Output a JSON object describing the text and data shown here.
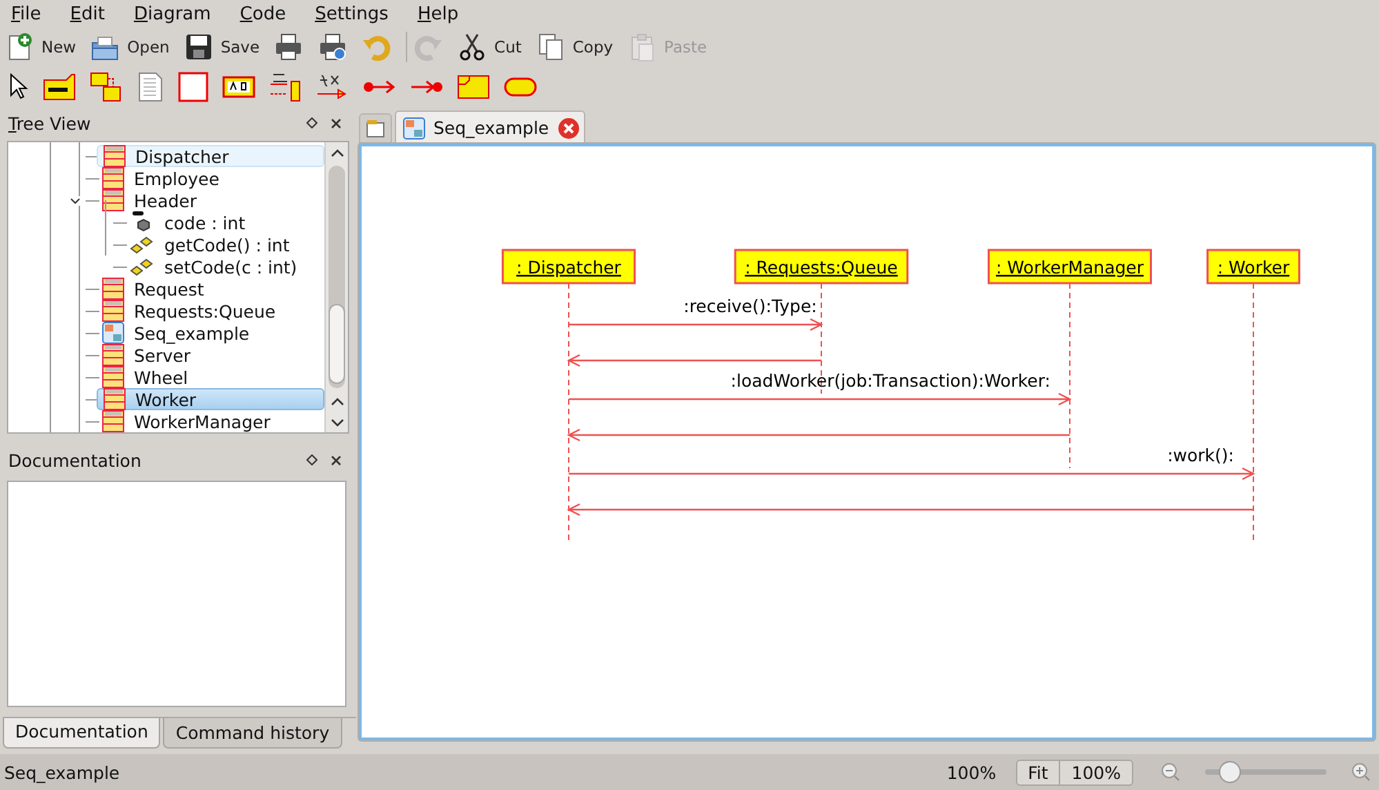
{
  "menu": [
    {
      "label": "File"
    },
    {
      "label": "Edit"
    },
    {
      "label": "Diagram"
    },
    {
      "label": "Code"
    },
    {
      "label": "Settings"
    },
    {
      "label": "Help"
    }
  ],
  "toolbar": [
    {
      "label": "New",
      "disabled": false
    },
    {
      "label": "Open",
      "disabled": false
    },
    {
      "label": "Save",
      "disabled": false
    },
    {
      "disabled": false
    },
    {
      "disabled": false
    },
    {
      "disabled": false
    },
    {
      "disabled": true
    },
    {
      "label": "Cut",
      "disabled": false
    },
    {
      "label": "Copy",
      "disabled": false
    },
    {
      "label": "Paste",
      "disabled": true
    }
  ],
  "tree_view": {
    "title": "Tree View",
    "items": [
      {
        "label": "Dispatcher",
        "kind": "class",
        "selected": false,
        "hovered": true
      },
      {
        "label": "Employee",
        "kind": "class",
        "selected": false,
        "hovered": false
      },
      {
        "label": "Header",
        "kind": "class",
        "selected": false,
        "hovered": false,
        "expanded": true,
        "children": [
          {
            "label": "code : int",
            "kind": "attribute",
            "selected": false,
            "hovered": false
          },
          {
            "label": "getCode() : int",
            "kind": "operation",
            "selected": false,
            "hovered": false
          },
          {
            "label": "setCode(c : int)",
            "kind": "operation",
            "selected": false,
            "hovered": false
          }
        ]
      },
      {
        "label": "Request",
        "kind": "class",
        "selected": false,
        "hovered": false
      },
      {
        "label": "Requests:Queue",
        "kind": "class",
        "selected": false,
        "hovered": false
      },
      {
        "label": "Seq_example",
        "kind": "diagram",
        "selected": false,
        "hovered": false
      },
      {
        "label": "Server",
        "kind": "class",
        "selected": false,
        "hovered": false
      },
      {
        "label": "Wheel",
        "kind": "class",
        "selected": false,
        "hovered": false
      },
      {
        "label": "Worker",
        "kind": "class",
        "selected": true,
        "hovered": false
      },
      {
        "label": "WorkerManager",
        "kind": "class",
        "selected": false,
        "hovered": false
      }
    ]
  },
  "documentation": {
    "title": "Documentation"
  },
  "bottom_tabs": [
    {
      "label": "Documentation",
      "selected": true
    },
    {
      "label": "Command history",
      "selected": false
    }
  ],
  "diagram_tabs": [
    {
      "label": "Seq_example",
      "selected": true
    }
  ],
  "diagram": {
    "objects": [
      {
        "name": ": Dispatcher"
      },
      {
        "name": ": Requests:Queue",
        "calls": [
          {
            "label": ":receive():Type:",
            "reply": true
          }
        ]
      },
      {
        "name": ": WorkerManager",
        "calls": [
          {
            "label": ":loadWorker(job:Transaction):Worker:",
            "reply": true
          }
        ]
      },
      {
        "name": ": Worker",
        "calls": [
          {
            "label": ":work():",
            "reply": true
          }
        ]
      }
    ]
  },
  "status_bar": {
    "text": "Seq_example",
    "zoom": "100%",
    "buttons": [
      "Fit",
      "100%"
    ],
    "slider": {
      "level": 0.2
    }
  }
}
